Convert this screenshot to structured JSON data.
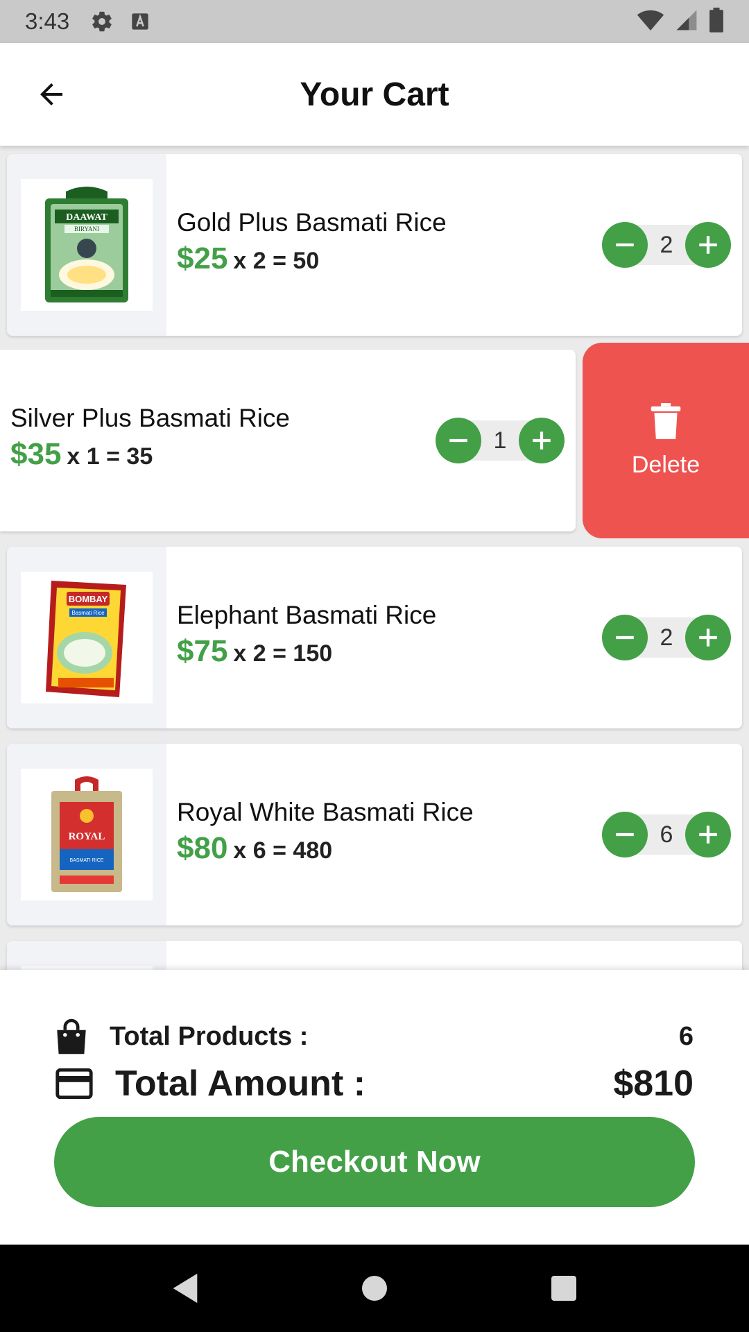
{
  "status_bar": {
    "time": "3:43"
  },
  "header": {
    "title": "Your Cart"
  },
  "items": [
    {
      "name": "Gold Plus Basmati Rice",
      "price": "$25",
      "calc": "x 2 = 50",
      "qty": "2"
    },
    {
      "name": "Silver Plus Basmati Rice",
      "price": "$35",
      "calc": "x 1 = 35",
      "qty": "1"
    },
    {
      "name": "Elephant Basmati Rice",
      "price": "$75",
      "calc": "x 2 = 150",
      "qty": "2"
    },
    {
      "name": "Royal White Basmati Rice",
      "price": "$80",
      "calc": "x 6 = 480",
      "qty": "6"
    }
  ],
  "swipe_action": {
    "label": "Delete"
  },
  "summary": {
    "products_label": "Total Products :",
    "products_value": "6",
    "amount_label": "Total Amount :",
    "amount_value": "$810",
    "checkout_label": "Checkout Now"
  },
  "package_labels": {
    "daawat": "DAAWAT",
    "daawat_sub": "BIRYANI",
    "bombay": "BOMBAY",
    "bombay_sub": "Basmati Rice",
    "royal": "ROYAL",
    "royal_sub": "BASMATI RICE"
  },
  "colors": {
    "accent": "#43a047",
    "delete": "#ef5350"
  }
}
